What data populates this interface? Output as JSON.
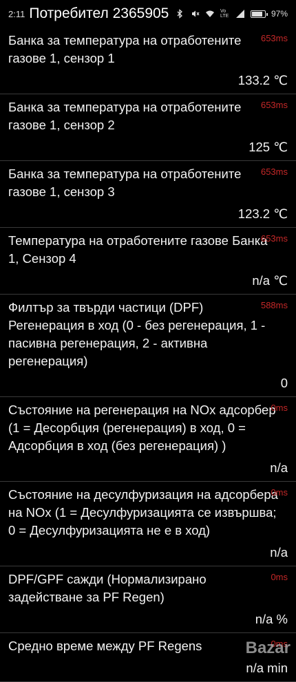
{
  "status_bar": {
    "time": "2:11",
    "overlay_title": "Потребител 2365905",
    "signal_label": "Vo LTE",
    "battery_percent": "97%",
    "battery_level": 0.97
  },
  "rows": [
    {
      "label": "Банка за температура на отработените газове 1, сензор 1",
      "time": "653ms",
      "value": "133.2 ℃"
    },
    {
      "label": "Банка за температура на отработените газове 1, сензор 2",
      "time": "653ms",
      "value": "125 ℃"
    },
    {
      "label": "Банка за температура на отработените газове 1, сензор 3",
      "time": "653ms",
      "value": "123.2 ℃"
    },
    {
      "label": "Температура на отработените газове Банка 1, Сензор 4",
      "time": "653ms",
      "value": "n/a ℃"
    },
    {
      "label": "Филтър за твърди частици (DPF) Регенерация в ход (0 - без регенерация, 1 - пасивна регенерация, 2 - активна регенерация)",
      "time": "588ms",
      "value": "0"
    },
    {
      "label": "Състояние на регенерация на NOx адсорбер (1 = Десорбция (регенерация) в ход, 0 = Адсорбция в ход (без регенерация) )",
      "time": "0ms",
      "value": "n/a"
    },
    {
      "label": "Състояние на десулфуризация на адсорбера на NOx (1 = Десулфуризацията се извършва; 0 = Десулфуризацията не е в ход)",
      "time": "0ms",
      "value": "n/a"
    },
    {
      "label": "DPF/GPF сажди (Нормализирано задействане за PF Regen)",
      "time": "0ms",
      "value": "n/a %"
    },
    {
      "label": "Средно време между PF Regens",
      "time": "0ms",
      "value": "n/a min"
    }
  ],
  "watermark": "Bazar"
}
